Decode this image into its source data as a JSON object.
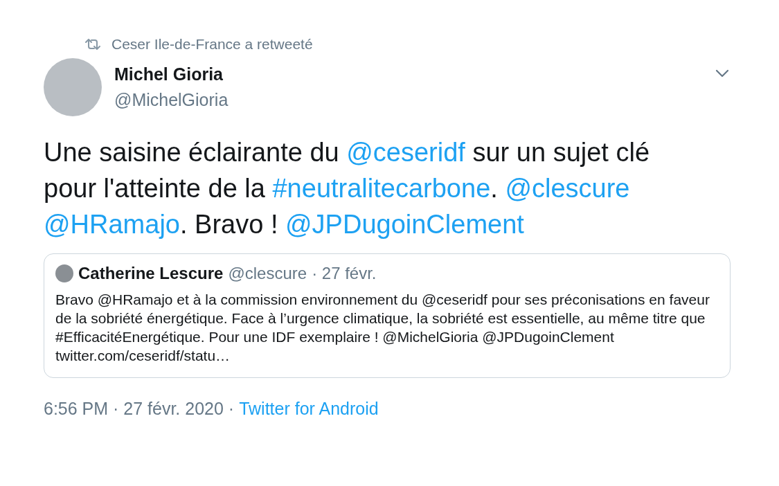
{
  "retweet_notice": "Ceser Ile-de-France a retweeté",
  "author": {
    "name": "Michel Gioria",
    "handle": "@MichelGioria"
  },
  "text": [
    {
      "kind": "text",
      "text": "Une saisine éclairante du "
    },
    {
      "kind": "link",
      "text": "@ceseridf"
    },
    {
      "kind": "text",
      "text": " sur un sujet clé"
    },
    {
      "kind": "break"
    },
    {
      "kind": "text",
      "text": "pour l'atteinte de la "
    },
    {
      "kind": "link",
      "text": "#neutralitecarbone"
    },
    {
      "kind": "text",
      "text": ". "
    },
    {
      "kind": "link",
      "text": "@clescure"
    },
    {
      "kind": "break"
    },
    {
      "kind": "link",
      "text": "@HRamajo"
    },
    {
      "kind": "text",
      "text": ". Bravo ! "
    },
    {
      "kind": "link",
      "text": "@JPDugoinClement"
    }
  ],
  "quoted": {
    "name": "Catherine Lescure",
    "handle": "@clescure",
    "date": "· 27 févr.",
    "text": "Bravo @HRamajo et à la commission environnement du @ceseridf pour ses préconisations en faveur de la sobriété énergétique. Face à l’urgence climatique, la sobriété est essentielle, au même titre que #EfficacitéEnergétique. Pour une IDF exemplaire ! @MichelGioria @JPDugoinClement twitter.com/ceseridf/statu…"
  },
  "footer": {
    "time": "6:56 PM · 27 févr. 2020 ·",
    "source": "Twitter for Android"
  }
}
